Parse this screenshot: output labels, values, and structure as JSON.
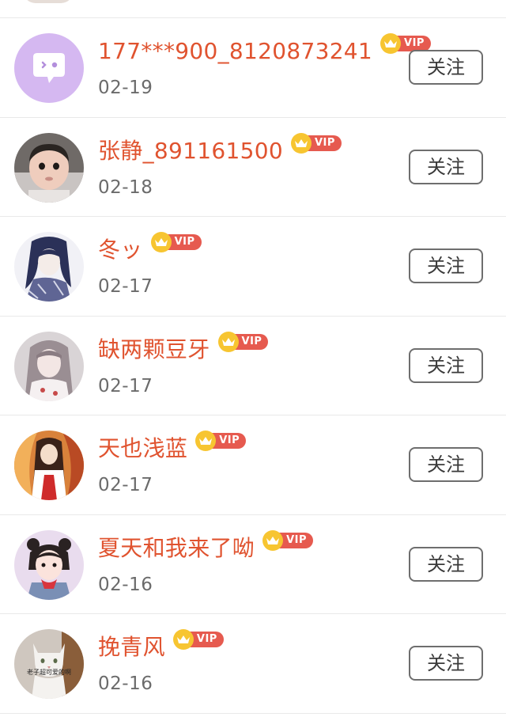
{
  "follow_label": "关注",
  "vip_label": "VIP",
  "items": [
    {
      "name": "177***900_8120873241",
      "date": "02-19",
      "avatar": "default-chat-avatar"
    },
    {
      "name": "张静_891161500",
      "date": "02-18",
      "avatar": "baby-photo-avatar"
    },
    {
      "name": "冬ッ",
      "date": "02-17",
      "avatar": "anime-girl-blue-avatar"
    },
    {
      "name": "缺两颗豆牙",
      "date": "02-17",
      "avatar": "anime-girl-white-avatar"
    },
    {
      "name": "天也浅蓝",
      "date": "02-17",
      "avatar": "anime-girl-kimono-avatar"
    },
    {
      "name": "夏天和我来了呦",
      "date": "02-16",
      "avatar": "girl-cartoon-avatar"
    },
    {
      "name": "挽青风",
      "date": "02-16",
      "avatar": "cat-photo-avatar",
      "avatar_caption": "老子超可爱的啊"
    }
  ]
}
